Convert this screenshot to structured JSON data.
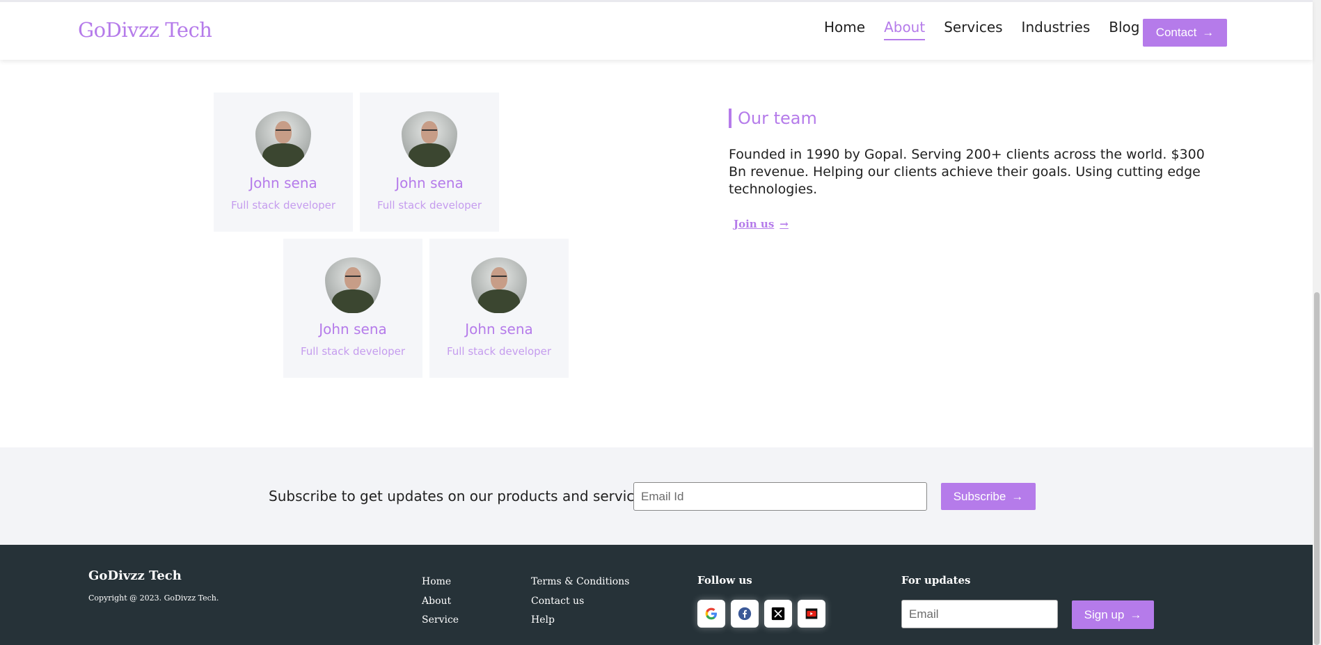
{
  "header": {
    "logo": "GoDivzz Tech",
    "nav": [
      "Home",
      "About",
      "Services",
      "Industries",
      "Blog"
    ],
    "active_nav": "About",
    "contact_label": "Contact",
    "arrow": "→"
  },
  "team_cards": [
    {
      "name": "John sena",
      "role": "Full stack developer"
    },
    {
      "name": "John sena",
      "role": "Full stack developer"
    },
    {
      "name": "John sena",
      "role": "Full stack developer"
    },
    {
      "name": "John sena",
      "role": "Full stack developer"
    }
  ],
  "our_team": {
    "title": "Our team",
    "description": "Founded in 1990 by Gopal. Serving 200+ clients across the world. $300 Bn revenue. Helping our clients achieve their goals. Using cutting edge technologies.",
    "join_label": "Join us",
    "arrow": "→"
  },
  "subscribe": {
    "text": "Subscribe to get updates on our products and service..",
    "placeholder": "Email Id",
    "button_label": "Subscribe",
    "arrow": "→"
  },
  "footer": {
    "brand": "GoDivzz Tech",
    "copyright": "Copyright @ 2023. GoDivzz Tech.",
    "links_col1": [
      "Home",
      "About",
      "Service"
    ],
    "links_col2": [
      "Terms & Conditions",
      "Contact us",
      "Help"
    ],
    "follow_heading": "Follow us",
    "social_icons": [
      "google-icon",
      "facebook-icon",
      "x-icon",
      "youtube-icon"
    ],
    "updates_heading": "For updates",
    "email_placeholder": "Email",
    "signup_label": "Sign up",
    "arrow": "→"
  },
  "colors": {
    "accent": "#b57bea",
    "footer_bg": "#263238",
    "band_bg": "#f3f4f7",
    "card_bg": "#f5f6f9"
  }
}
